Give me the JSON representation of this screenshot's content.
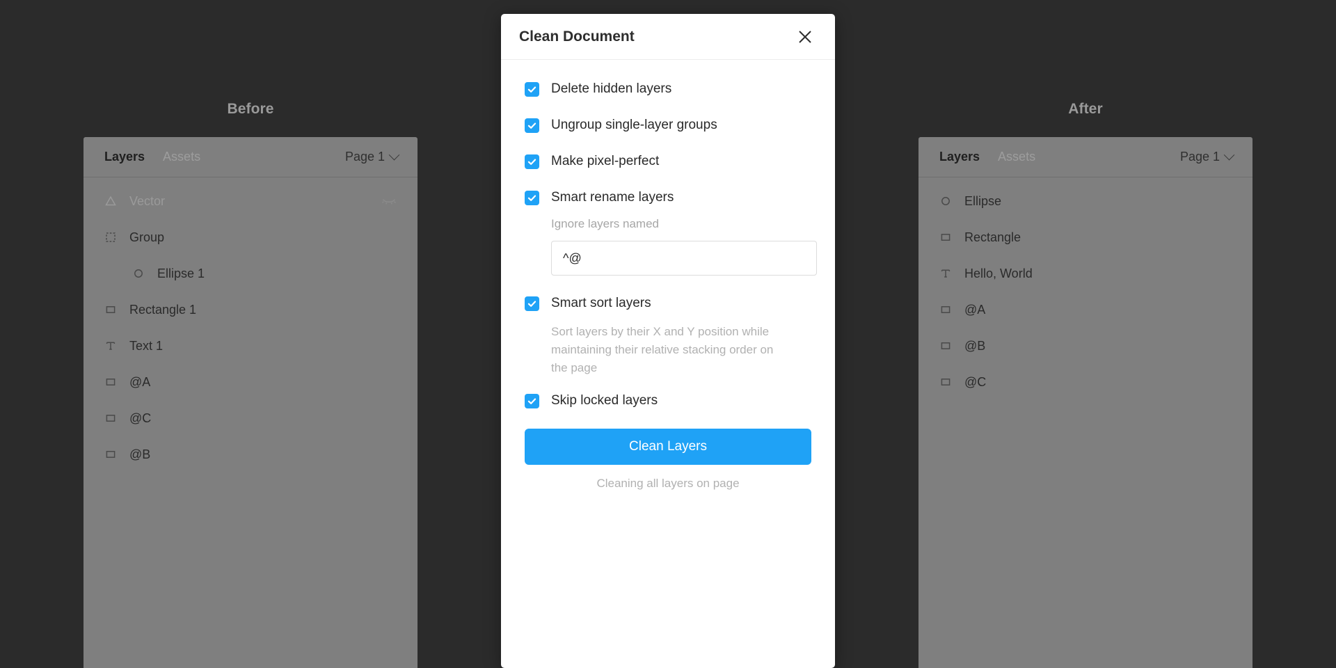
{
  "comparison": {
    "before": {
      "caption": "Before",
      "panel": {
        "tab_layers": "Layers",
        "tab_assets": "Assets",
        "page": "Page 1"
      },
      "layers": [
        {
          "icon": "vector-triangle-icon",
          "label": "Vector",
          "dim": true,
          "indent": false,
          "hidden_eye": true
        },
        {
          "icon": "group-icon",
          "label": "Group",
          "dim": false,
          "indent": false,
          "hidden_eye": false
        },
        {
          "icon": "ellipse-icon",
          "label": "Ellipse 1",
          "dim": false,
          "indent": true,
          "hidden_eye": false
        },
        {
          "icon": "rectangle-icon",
          "label": "Rectangle 1",
          "dim": false,
          "indent": false,
          "hidden_eye": false
        },
        {
          "icon": "text-icon",
          "label": "Text 1",
          "dim": false,
          "indent": false,
          "hidden_eye": false
        },
        {
          "icon": "rectangle-icon",
          "label": "@A",
          "dim": false,
          "indent": false,
          "hidden_eye": false
        },
        {
          "icon": "rectangle-icon",
          "label": "@C",
          "dim": false,
          "indent": false,
          "hidden_eye": false
        },
        {
          "icon": "rectangle-icon",
          "label": "@B",
          "dim": false,
          "indent": false,
          "hidden_eye": false
        }
      ]
    },
    "after": {
      "caption": "After",
      "panel": {
        "tab_layers": "Layers",
        "tab_assets": "Assets",
        "page": "Page 1"
      },
      "layers": [
        {
          "icon": "ellipse-icon",
          "label": "Ellipse",
          "dim": false,
          "indent": false,
          "hidden_eye": false
        },
        {
          "icon": "rectangle-icon",
          "label": "Rectangle",
          "dim": false,
          "indent": false,
          "hidden_eye": false
        },
        {
          "icon": "text-icon",
          "label": "Hello, World",
          "dim": false,
          "indent": false,
          "hidden_eye": false
        },
        {
          "icon": "rectangle-icon",
          "label": "@A",
          "dim": false,
          "indent": false,
          "hidden_eye": false
        },
        {
          "icon": "rectangle-icon",
          "label": "@B",
          "dim": false,
          "indent": false,
          "hidden_eye": false
        },
        {
          "icon": "rectangle-icon",
          "label": "@C",
          "dim": false,
          "indent": false,
          "hidden_eye": false
        }
      ]
    }
  },
  "dialog": {
    "title": "Clean Document",
    "close_icon": "close-icon",
    "options": {
      "delete_hidden": {
        "label": "Delete hidden layers",
        "checked": true
      },
      "ungroup_single": {
        "label": "Ungroup single-layer groups",
        "checked": true
      },
      "pixel_perfect": {
        "label": "Make pixel-perfect",
        "checked": true
      },
      "smart_rename": {
        "label": "Smart rename layers",
        "checked": true
      },
      "smart_sort": {
        "label": "Smart sort layers",
        "checked": true
      },
      "skip_locked": {
        "label": "Skip locked layers",
        "checked": true
      }
    },
    "ignore_field": {
      "label": "Ignore layers named",
      "value": "^@",
      "placeholder": "^@"
    },
    "sort_description": "Sort layers by their X and Y position while maintaining their relative stacking order on the page",
    "primary_button": "Clean Layers",
    "footnote": "Cleaning all layers on page"
  },
  "colors": {
    "accent": "#1FA2F6",
    "background": "#2b2b2b",
    "panel": "#7f7f7f",
    "dialog": "#ffffff"
  }
}
